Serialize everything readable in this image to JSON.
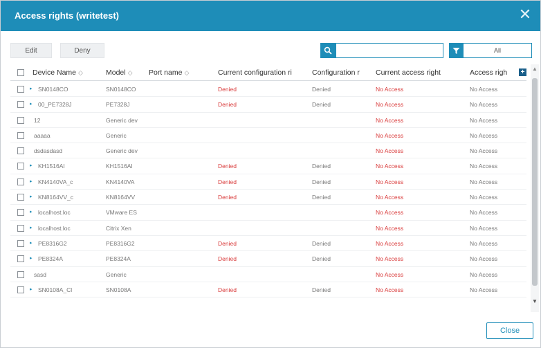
{
  "dialog": {
    "title": "Access rights (writetest)",
    "close_label": "Close"
  },
  "toolbar": {
    "edit_label": "Edit",
    "deny_label": "Deny",
    "search_value": "",
    "filter_value": "All"
  },
  "table": {
    "headers": {
      "device_name": "Device Name",
      "model": "Model",
      "port_name": "Port name",
      "current_config": "Current configuration ri",
      "config": "Configuration r",
      "current_access": "Current access right",
      "access": "Access righ"
    },
    "rows": [
      {
        "expandable": true,
        "device": "SN0148CO",
        "model": "SN0148CO",
        "port": "",
        "cur_config": "Denied",
        "config": "Denied",
        "cur_access": "No Access",
        "access": "No Access"
      },
      {
        "expandable": true,
        "device": "00_PE7328J",
        "model": "PE7328J",
        "port": "",
        "cur_config": "Denied",
        "config": "Denied",
        "cur_access": "No Access",
        "access": "No Access"
      },
      {
        "expandable": false,
        "device": "12",
        "model": "Generic dev",
        "port": "",
        "cur_config": "",
        "config": "",
        "cur_access": "No Access",
        "access": "No Access"
      },
      {
        "expandable": false,
        "device": "aaaaa",
        "model": "Generic",
        "port": "",
        "cur_config": "",
        "config": "",
        "cur_access": "No Access",
        "access": "No Access"
      },
      {
        "expandable": false,
        "device": "dsdasdasd",
        "model": "Generic dev",
        "port": "",
        "cur_config": "",
        "config": "",
        "cur_access": "No Access",
        "access": "No Access"
      },
      {
        "expandable": true,
        "device": "KH1516AI",
        "model": "KH1516AI",
        "port": "",
        "cur_config": "Denied",
        "config": "Denied",
        "cur_access": "No Access",
        "access": "No Access"
      },
      {
        "expandable": true,
        "device": "KN4140VA_c",
        "model": "KN4140VA",
        "port": "",
        "cur_config": "Denied",
        "config": "Denied",
        "cur_access": "No Access",
        "access": "No Access"
      },
      {
        "expandable": true,
        "device": "KN8164VV_c",
        "model": "KN8164VV",
        "port": "",
        "cur_config": "Denied",
        "config": "Denied",
        "cur_access": "No Access",
        "access": "No Access"
      },
      {
        "expandable": true,
        "device": "localhost.loc",
        "model": "VMware ES",
        "port": "",
        "cur_config": "",
        "config": "",
        "cur_access": "No Access",
        "access": "No Access"
      },
      {
        "expandable": true,
        "device": "localhost.loc",
        "model": "Citrix Xen",
        "port": "",
        "cur_config": "",
        "config": "",
        "cur_access": "No Access",
        "access": "No Access"
      },
      {
        "expandable": true,
        "device": "PE8316G2",
        "model": "PE8316G2",
        "port": "",
        "cur_config": "Denied",
        "config": "Denied",
        "cur_access": "No Access",
        "access": "No Access"
      },
      {
        "expandable": true,
        "device": "PE8324A",
        "model": "PE8324A",
        "port": "",
        "cur_config": "Denied",
        "config": "Denied",
        "cur_access": "No Access",
        "access": "No Access"
      },
      {
        "expandable": false,
        "device": "sasd",
        "model": "Generic",
        "port": "",
        "cur_config": "",
        "config": "",
        "cur_access": "No Access",
        "access": "No Access"
      },
      {
        "expandable": true,
        "device": "SN0108A_Cl",
        "model": "SN0108A",
        "port": "",
        "cur_config": "Denied",
        "config": "Denied",
        "cur_access": "No Access",
        "access": "No Access"
      }
    ]
  }
}
